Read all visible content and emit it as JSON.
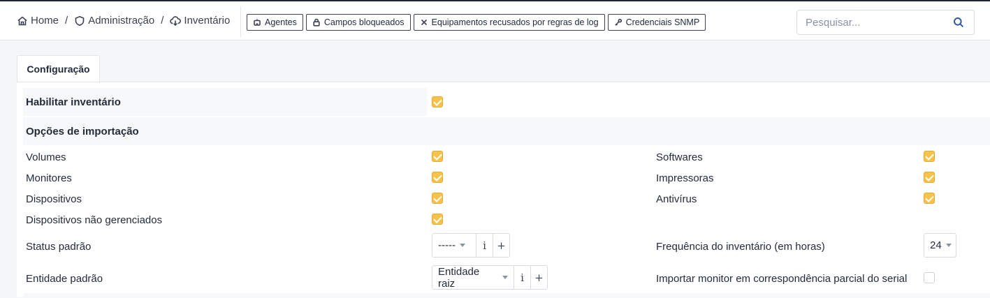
{
  "breadcrumb": {
    "items": [
      {
        "label": "Home",
        "icon": "home-icon"
      },
      {
        "label": "Administração",
        "icon": "shield-icon"
      },
      {
        "label": "Inventário",
        "icon": "cloud-download-icon"
      }
    ],
    "separator": "/"
  },
  "toolbar": {
    "agents": "Agentes",
    "locked_fields": "Campos bloqueados",
    "refused": "Equipamentos recusados por regras de log",
    "snmp": "Credenciais SNMP"
  },
  "search": {
    "placeholder": "Pesquisar...",
    "value": ""
  },
  "tabs": [
    {
      "label": "Configuração",
      "active": true
    }
  ],
  "form": {
    "enable_inventory": {
      "label": "Habilitar inventário",
      "checked": true
    },
    "import_options_title": "Opções de importação",
    "left_options": [
      {
        "label": "Volumes",
        "checked": true
      },
      {
        "label": "Monitores",
        "checked": true
      },
      {
        "label": "Dispositivos",
        "checked": true
      },
      {
        "label": "Dispositivos não gerenciados",
        "checked": true
      }
    ],
    "right_options": [
      {
        "label": "Softwares",
        "checked": true
      },
      {
        "label": "Impressoras",
        "checked": true
      },
      {
        "label": "Antivírus",
        "checked": true
      }
    ],
    "default_status": {
      "label": "Status padrão",
      "value": "-----",
      "info": "i",
      "add": "+"
    },
    "default_entity": {
      "label": "Entidade padrão",
      "value": "Entidade raiz",
      "info": "i",
      "add": "+"
    },
    "frequency": {
      "label": "Frequência do inventário (em horas)",
      "value": "24"
    },
    "partial_serial": {
      "label": "Importar monitor em correspondência parcial do serial",
      "checked": false
    }
  },
  "colors": {
    "accent": "#f6c24b",
    "link": "#2f5b9a",
    "text": "#232c3b"
  }
}
